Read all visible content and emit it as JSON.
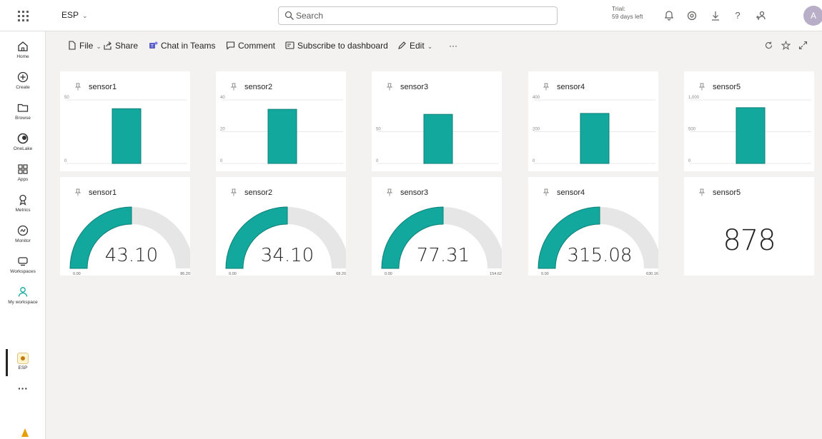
{
  "topbar": {
    "workspace": "ESP",
    "search_placeholder": "Search",
    "trial_line1": "Trial:",
    "trial_line2": "59 days left",
    "icons": [
      "waffle-icon",
      "bell-icon",
      "settings-icon",
      "download-icon",
      "help-icon",
      "share-people-icon"
    ],
    "help_glyph": "?",
    "avatar_initial": "A"
  },
  "rail": {
    "items": [
      {
        "label": "Home",
        "icon": "home-icon"
      },
      {
        "label": "Create",
        "icon": "create-icon"
      },
      {
        "label": "Browse",
        "icon": "browse-icon"
      },
      {
        "label": "OneLake",
        "icon": "onelake-icon"
      },
      {
        "label": "Apps",
        "icon": "apps-icon"
      },
      {
        "label": "Metrics",
        "icon": "metrics-icon"
      },
      {
        "label": "Monitor",
        "icon": "monitor-icon"
      },
      {
        "label": "Workspaces",
        "icon": "workspaces-icon"
      },
      {
        "label": "My workspace",
        "icon": "my-workspace-icon"
      },
      {
        "label": "ESP",
        "icon": "esp-dashboard-icon"
      }
    ],
    "more": "···"
  },
  "commands": {
    "file": "File",
    "share": "Share",
    "chat": "Chat in Teams",
    "comment": "Comment",
    "subscribe": "Subscribe to dashboard",
    "edit": "Edit",
    "more": "···"
  },
  "colors": {
    "teal": "#13a89e",
    "teal_border": "#0e7f77",
    "gauge_track": "#e6e6e6",
    "background": "#f3f2f1"
  },
  "bar_tiles": [
    {
      "title": "sensor1",
      "chart_data": {
        "type": "bar",
        "value": 43.1,
        "ylim": [
          0,
          50
        ],
        "tick_labels": [
          "50",
          "0"
        ]
      }
    },
    {
      "title": "sensor2",
      "chart_data": {
        "type": "bar",
        "value": 34.1,
        "ylim": [
          0,
          40
        ],
        "tick_labels": [
          "40",
          "20",
          "0"
        ]
      }
    },
    {
      "title": "sensor3",
      "chart_data": {
        "type": "bar",
        "value": 77.31,
        "ylim": [
          0,
          100
        ],
        "tick_labels": [
          "50",
          "0"
        ]
      }
    },
    {
      "title": "sensor4",
      "chart_data": {
        "type": "bar",
        "value": 315.08,
        "ylim": [
          0,
          400
        ],
        "tick_labels": [
          "400",
          "200",
          "0"
        ]
      }
    },
    {
      "title": "sensor5",
      "chart_data": {
        "type": "bar",
        "value": 878,
        "ylim": [
          0,
          1000
        ],
        "tick_labels": [
          "1,000",
          "500",
          "0"
        ]
      }
    }
  ],
  "gauge_tiles": [
    {
      "title": "sensor1",
      "value": 43.1,
      "max": 86.2,
      "display": "43.10",
      "min_label": "0.00",
      "max_label": "86.20"
    },
    {
      "title": "sensor2",
      "value": 34.1,
      "max": 68.2,
      "display": "34.10",
      "min_label": "0.00",
      "max_label": "68.20"
    },
    {
      "title": "sensor3",
      "value": 77.31,
      "max": 154.62,
      "display": "77.31",
      "min_label": "0.00",
      "max_label": "154.62"
    },
    {
      "title": "sensor4",
      "value": 315.08,
      "max": 630.16,
      "display": "315.08",
      "min_label": "0.00",
      "max_label": "630.16"
    }
  ],
  "card_tile": {
    "title": "sensor5",
    "value": "878"
  }
}
